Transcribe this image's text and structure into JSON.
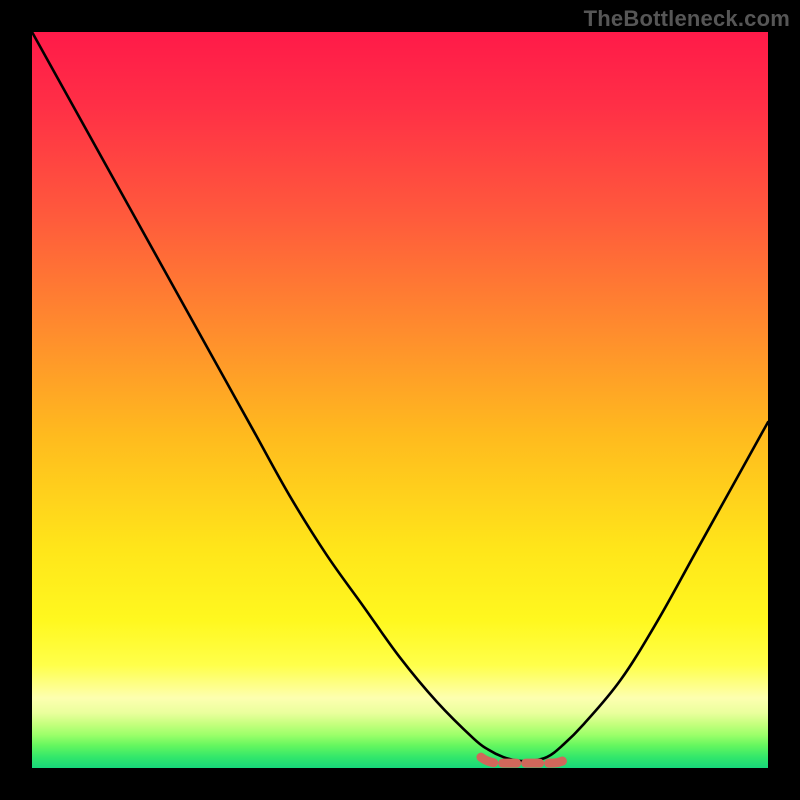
{
  "watermark": "TheBottleneck.com",
  "colors": {
    "frame": "#000000",
    "curve": "#000000",
    "marker": "#d1675b",
    "gradient_stops": [
      {
        "offset": 0.0,
        "color": "#ff1a49"
      },
      {
        "offset": 0.1,
        "color": "#ff2f46"
      },
      {
        "offset": 0.25,
        "color": "#ff5a3c"
      },
      {
        "offset": 0.4,
        "color": "#ff8a2e"
      },
      {
        "offset": 0.55,
        "color": "#ffbb1e"
      },
      {
        "offset": 0.7,
        "color": "#ffe51a"
      },
      {
        "offset": 0.8,
        "color": "#fff81f"
      },
      {
        "offset": 0.86,
        "color": "#ffff4a"
      },
      {
        "offset": 0.905,
        "color": "#fdffb0"
      },
      {
        "offset": 0.925,
        "color": "#eaff9d"
      },
      {
        "offset": 0.94,
        "color": "#c6ff7e"
      },
      {
        "offset": 0.955,
        "color": "#9cff6a"
      },
      {
        "offset": 0.97,
        "color": "#63f65f"
      },
      {
        "offset": 0.985,
        "color": "#33e76a"
      },
      {
        "offset": 1.0,
        "color": "#17d77a"
      }
    ]
  },
  "chart_data": {
    "type": "line",
    "title": "",
    "xlabel": "",
    "ylabel": "",
    "xlim": [
      0,
      100
    ],
    "ylim": [
      0,
      100
    ],
    "x": [
      0,
      5,
      10,
      15,
      20,
      25,
      30,
      35,
      40,
      45,
      50,
      55,
      60,
      62,
      64,
      66,
      68,
      70,
      72,
      75,
      80,
      85,
      90,
      95,
      100
    ],
    "values": [
      100,
      91,
      82,
      73,
      64,
      55,
      46,
      37,
      29,
      22,
      15,
      9,
      4,
      2.5,
      1.5,
      1,
      1,
      1.5,
      3,
      6,
      12,
      20,
      29,
      38,
      47
    ],
    "flat_region": {
      "x_start": 61,
      "x_end": 73,
      "y": 1.2
    },
    "annotation": "Bottom flat segment is highlighted with salmon dashed markers"
  }
}
